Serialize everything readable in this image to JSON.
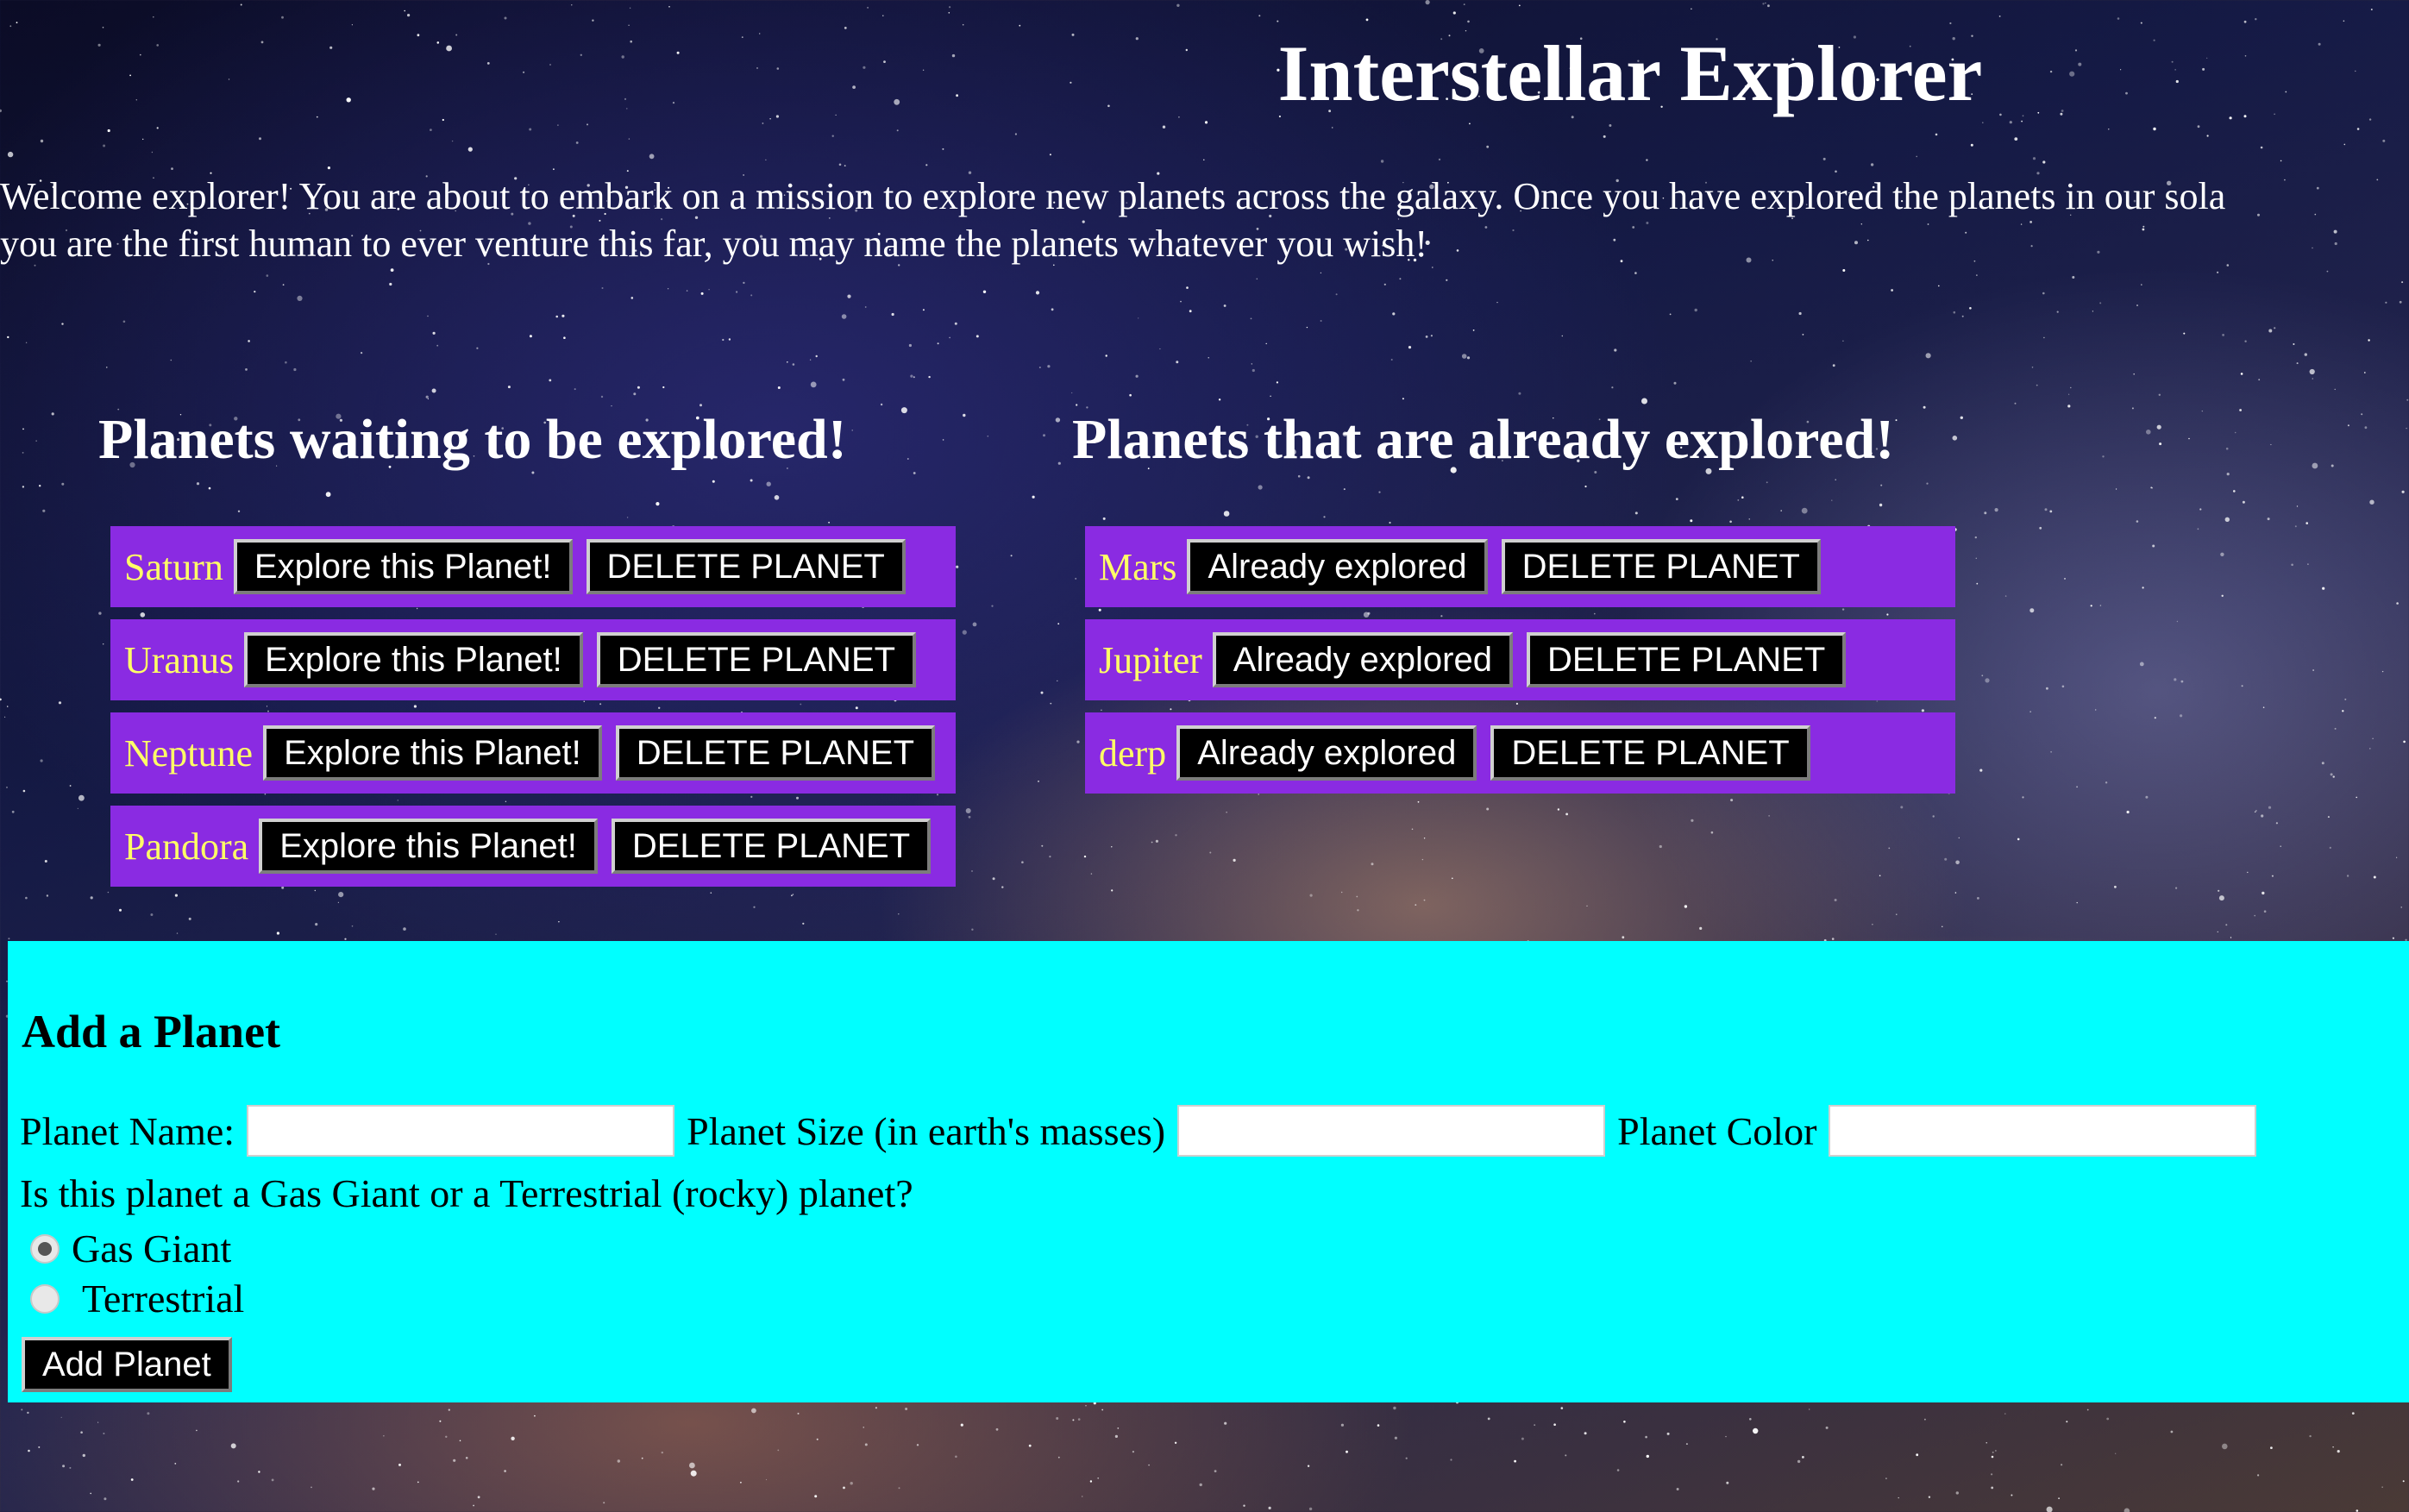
{
  "header": {
    "title": "Interstellar Explorer"
  },
  "intro": {
    "line1": "Welcome explorer! You are about to embark on a mission to explore new planets across the galaxy. Once you have explored the planets in our sola",
    "line2": "you are the first human to ever venture this far, you may name the planets whatever you wish!"
  },
  "unexplored": {
    "heading": "Planets waiting to be explored!",
    "planets": [
      {
        "name": "Saturn",
        "action": "Explore this Planet!",
        "delete": "DELETE PLANET"
      },
      {
        "name": "Uranus",
        "action": "Explore this Planet!",
        "delete": "DELETE PLANET"
      },
      {
        "name": "Neptune",
        "action": "Explore this Planet!",
        "delete": "DELETE PLANET"
      },
      {
        "name": "Pandora",
        "action": "Explore this Planet!",
        "delete": "DELETE PLANET"
      }
    ]
  },
  "explored": {
    "heading": "Planets that are already explored!",
    "planets": [
      {
        "name": "Mars",
        "action": "Already explored",
        "delete": "DELETE PLANET"
      },
      {
        "name": "Jupiter",
        "action": "Already explored",
        "delete": "DELETE PLANET"
      },
      {
        "name": "derp",
        "action": "Already explored",
        "delete": "DELETE PLANET"
      }
    ]
  },
  "add_form": {
    "title": "Add a Planet",
    "name_label": "Planet Name:",
    "name_value": "",
    "size_label": "Planet Size (in earth's masses)",
    "size_value": "",
    "color_label": "Planet Color",
    "color_value": "",
    "question": "Is this planet a Gas Giant or a Terrestrial (rocky) planet?",
    "options": [
      {
        "label": "Gas Giant",
        "checked": true
      },
      {
        "label": "Terrestrial",
        "checked": false
      }
    ],
    "submit_label": "Add Planet"
  },
  "colors": {
    "planet_row": "#8a2be2",
    "planet_name": "#ffff66",
    "form_panel": "#00ffff",
    "button_bg": "#000000"
  }
}
